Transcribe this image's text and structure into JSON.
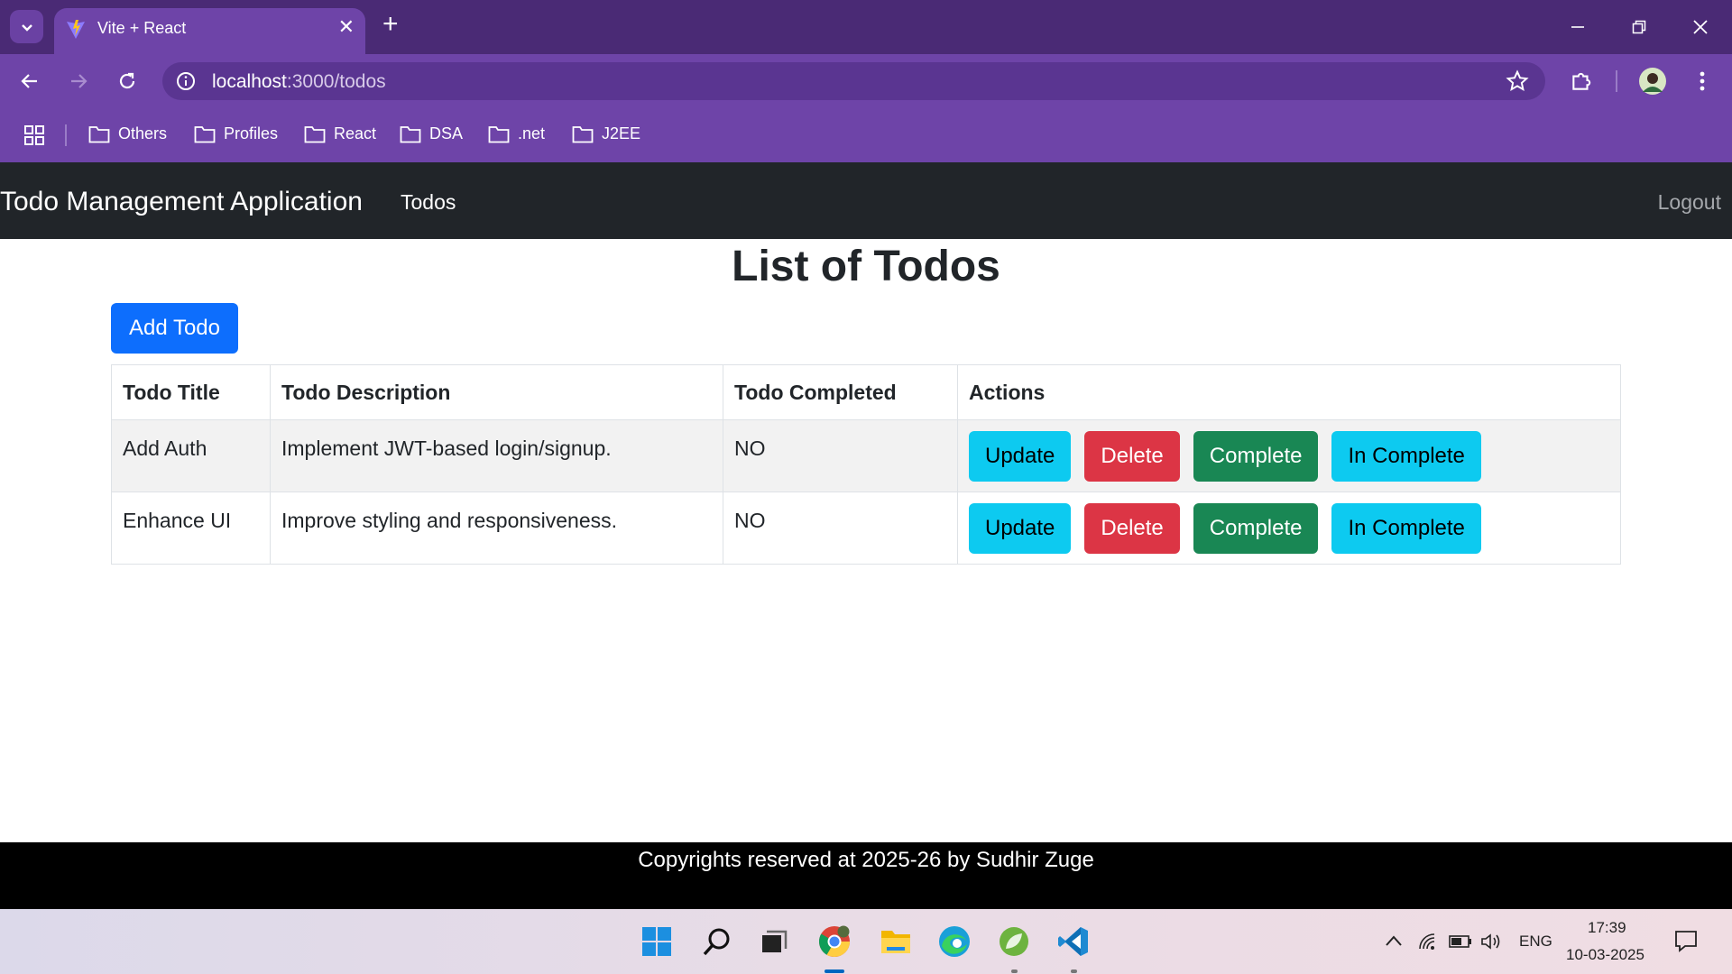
{
  "browser": {
    "tab_title": "Vite + React",
    "url_host": "localhost",
    "url_rest": ":3000/todos",
    "bookmarks": [
      "Others",
      "Profiles",
      "React",
      "DSA",
      ".net",
      "J2EE"
    ]
  },
  "app": {
    "brand": "Todo Management Application",
    "nav_todos": "Todos",
    "nav_logout": "Logout",
    "title": "List of Todos",
    "add_button": "Add Todo",
    "table": {
      "headers": [
        "Todo Title",
        "Todo Description",
        "Todo Completed",
        "Actions"
      ],
      "rows": [
        {
          "title": "Add Auth",
          "description": "Implement JWT-based login/signup.",
          "completed": "NO"
        },
        {
          "title": "Enhance UI",
          "description": "Improve styling and responsiveness.",
          "completed": "NO"
        }
      ],
      "actions": {
        "update": "Update",
        "delete": "Delete",
        "complete": "Complete",
        "incomplete": "In Complete"
      }
    },
    "footer": "Copyrights reserved at 2025-26 by Sudhir Zuge"
  },
  "taskbar": {
    "lang": "ENG",
    "time": "17:39",
    "date": "10-03-2025"
  },
  "colors": {
    "primary": "#0d6efd",
    "info": "#0dcaf0",
    "danger": "#dc3545",
    "success": "#198754",
    "navbar": "#212529",
    "browser_accent": "#6e44a8"
  }
}
